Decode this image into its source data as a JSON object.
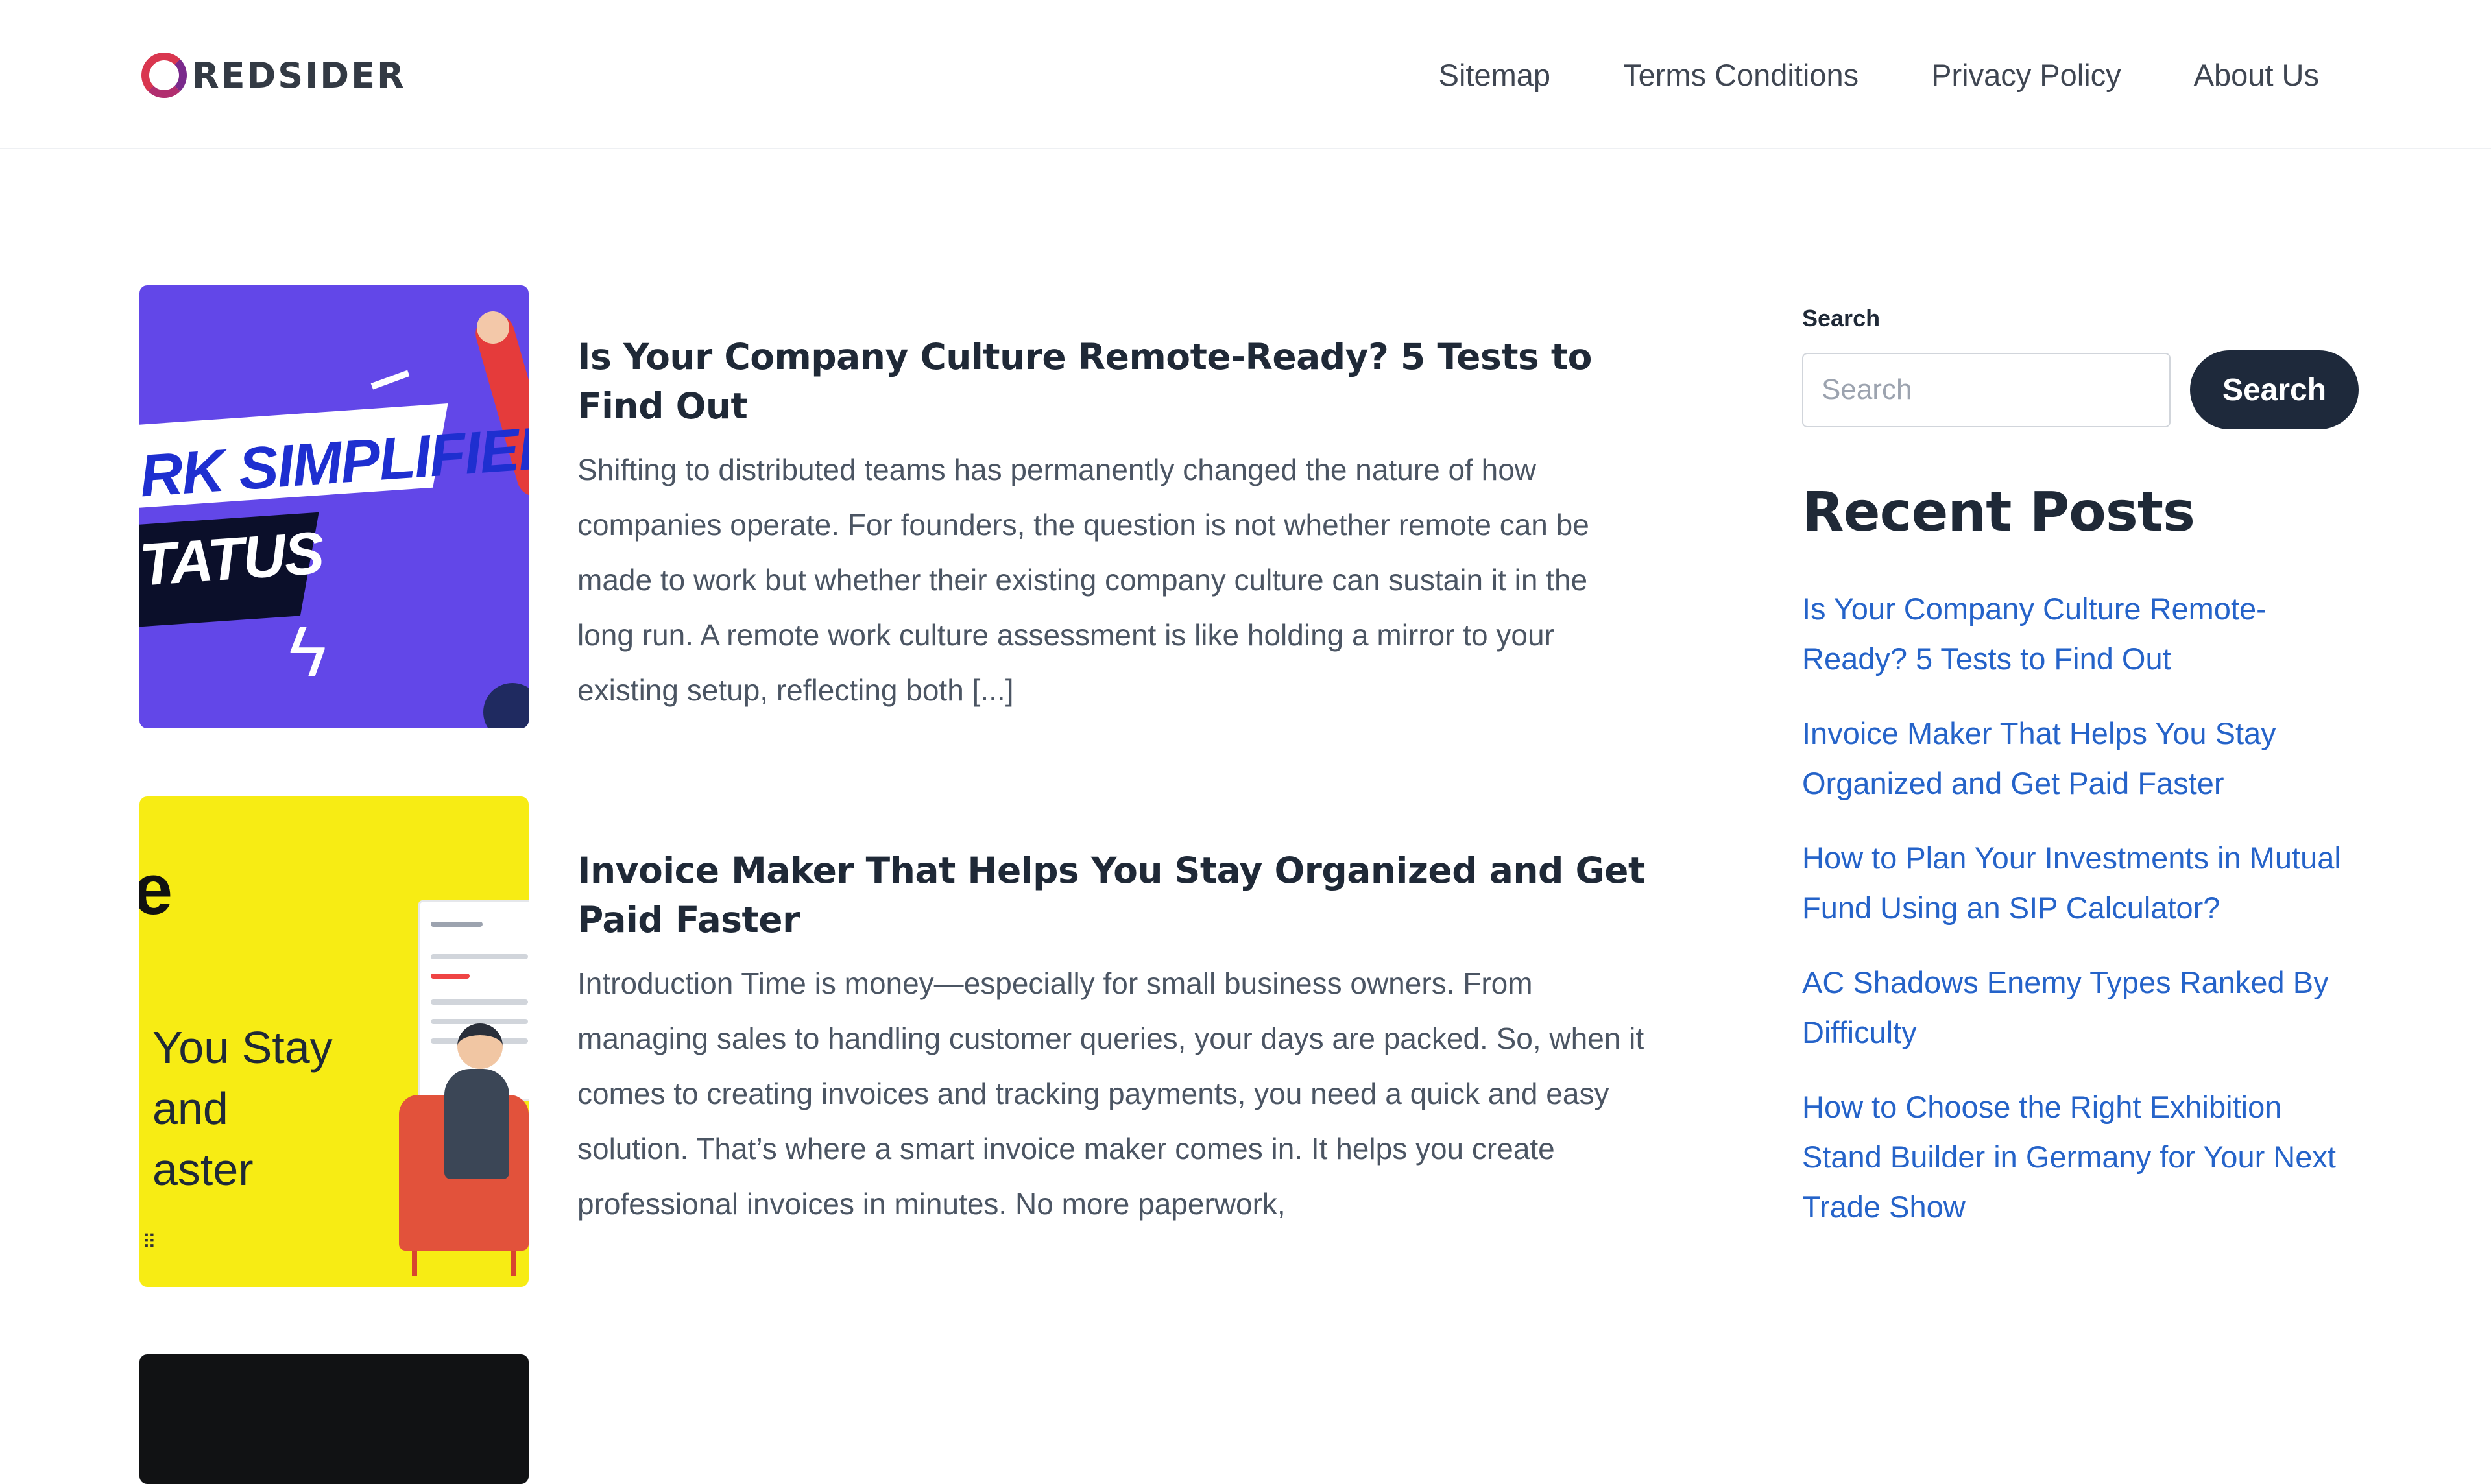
{
  "brand": {
    "name": "REDSIDER"
  },
  "nav": [
    {
      "label": "Sitemap"
    },
    {
      "label": "Terms Conditions"
    },
    {
      "label": "Privacy Policy"
    },
    {
      "label": "About Us"
    }
  ],
  "posts": [
    {
      "title": "Is Your Company Culture Remote-Ready? 5 Tests to Find Out",
      "excerpt": "Shifting to distributed teams has permanently changed the nature of how companies operate. For founders, the question is not whether remote can be made to work but whether their existing company culture can sustain it in the long run. A remote work culture assessment is like holding a mirror to your existing setup, reflecting both [...]",
      "thumb_line1": "RK SIMPLIFIED",
      "thumb_line2": "TATUS"
    },
    {
      "title": "Invoice Maker That Helps You Stay Organized and Get Paid Faster",
      "excerpt": "Introduction Time is money—especially for small business owners. From managing sales to handling customer queries, your days are packed. So, when it comes to creating invoices and tracking payments, you need a quick and easy solution. That’s where a smart invoice maker comes in. It helps you create professional invoices in minutes. No more paperwork,",
      "thumb_letter": "e",
      "thumb_text": "You Stay\nand\naster"
    }
  ],
  "sidebar": {
    "search_label": "Search",
    "search_placeholder": "Search",
    "search_button": "Search",
    "recent_title": "Recent Posts",
    "recent_posts": [
      {
        "label": "Is Your Company Culture Remote-Ready? 5 Tests to Find Out"
      },
      {
        "label": "Invoice Maker That Helps You Stay Organized and Get Paid Faster"
      },
      {
        "label": "How to Plan Your Investments in Mutual Fund Using an SIP Calculator?"
      },
      {
        "label": "AC Shadows Enemy Types Ranked By Difficulty"
      },
      {
        "label": "How to Choose the Right Exhibition Stand Builder in Germany for Your Next Trade Show"
      }
    ]
  }
}
